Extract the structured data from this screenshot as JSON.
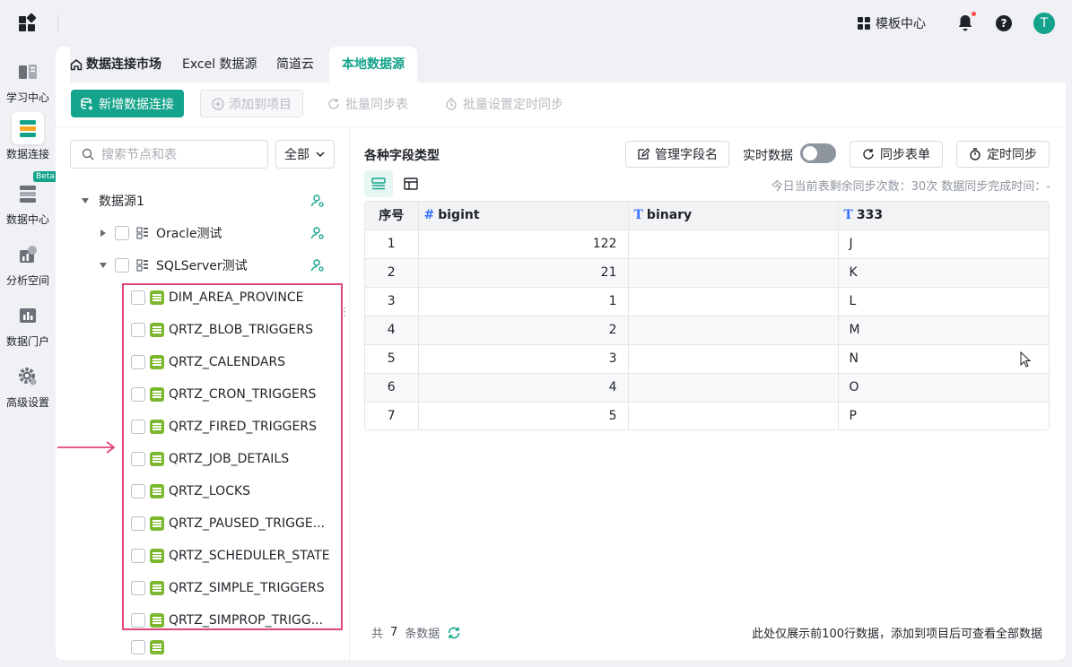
{
  "topbar": {
    "template_center": "模板中心",
    "help_label": "?",
    "avatar_letter": "T"
  },
  "rail": {
    "items": [
      {
        "label": "学习中心",
        "icon": "book-icon"
      },
      {
        "label": "数据连接",
        "icon": "data-connect-icon",
        "active": true
      },
      {
        "label": "数据中心",
        "icon": "server-icon",
        "badge": "Beta"
      },
      {
        "label": "分析空间",
        "icon": "chart-pie-icon"
      },
      {
        "label": "数据门户",
        "icon": "bar-chart-icon"
      },
      {
        "label": "高级设置",
        "icon": "gear-icon"
      }
    ]
  },
  "tabs": [
    {
      "label": "数据连接市场",
      "icon": "home-icon"
    },
    {
      "label": "Excel 数据源"
    },
    {
      "label": "简道云"
    },
    {
      "label": "本地数据源",
      "active": true
    }
  ],
  "toolbar": {
    "new_connection": "新增数据连接",
    "add_to_project": "添加到项目",
    "batch_sync": "批量同步表",
    "batch_schedule": "批量设置定时同步"
  },
  "tree": {
    "search_placeholder": "搜索节点和表",
    "scope": "全部",
    "root": "数据源1",
    "connections": [
      "Oracle测试",
      "SQLServer测试"
    ],
    "tables": [
      "DIM_AREA_PROVINCE",
      "QRTZ_BLOB_TRIGGERS",
      "QRTZ_CALENDARS",
      "QRTZ_CRON_TRIGGERS",
      "QRTZ_FIRED_TRIGGERS",
      "QRTZ_JOB_DETAILS",
      "QRTZ_LOCKS",
      "QRTZ_PAUSED_TRIGGE...",
      "QRTZ_SCHEDULER_STATE",
      "QRTZ_SIMPLE_TRIGGERS",
      "QRTZ_SIMPROP_TRIGG..."
    ]
  },
  "data_pane": {
    "title": "各种字段类型",
    "manage_fields": "管理字段名",
    "realtime_label": "实时数据",
    "sync_table": "同步表单",
    "schedule_sync": "定时同步",
    "sync_info": "今日当前表剩余同步次数：30次    数据同步完成时间：-",
    "columns": [
      "序号",
      "bigint",
      "binary",
      "333"
    ],
    "column_types": [
      "",
      "#",
      "T",
      "T"
    ],
    "rows": [
      [
        "1",
        "122",
        "",
        "J"
      ],
      [
        "2",
        "21",
        "",
        "K"
      ],
      [
        "3",
        "1",
        "",
        "L"
      ],
      [
        "4",
        "2",
        "",
        "M"
      ],
      [
        "5",
        "3",
        "",
        "N"
      ],
      [
        "6",
        "4",
        "",
        "O"
      ],
      [
        "7",
        "5",
        "",
        "P"
      ]
    ],
    "footer_prefix": "共",
    "footer_count": "7",
    "footer_suffix": "条数据",
    "footer_note": "此处仅展示前100行数据，添加到项目后可查看全部数据"
  },
  "colors": {
    "accent": "#14a38b",
    "highlight": "#e0457b",
    "table_icon": "#7cb82f"
  }
}
